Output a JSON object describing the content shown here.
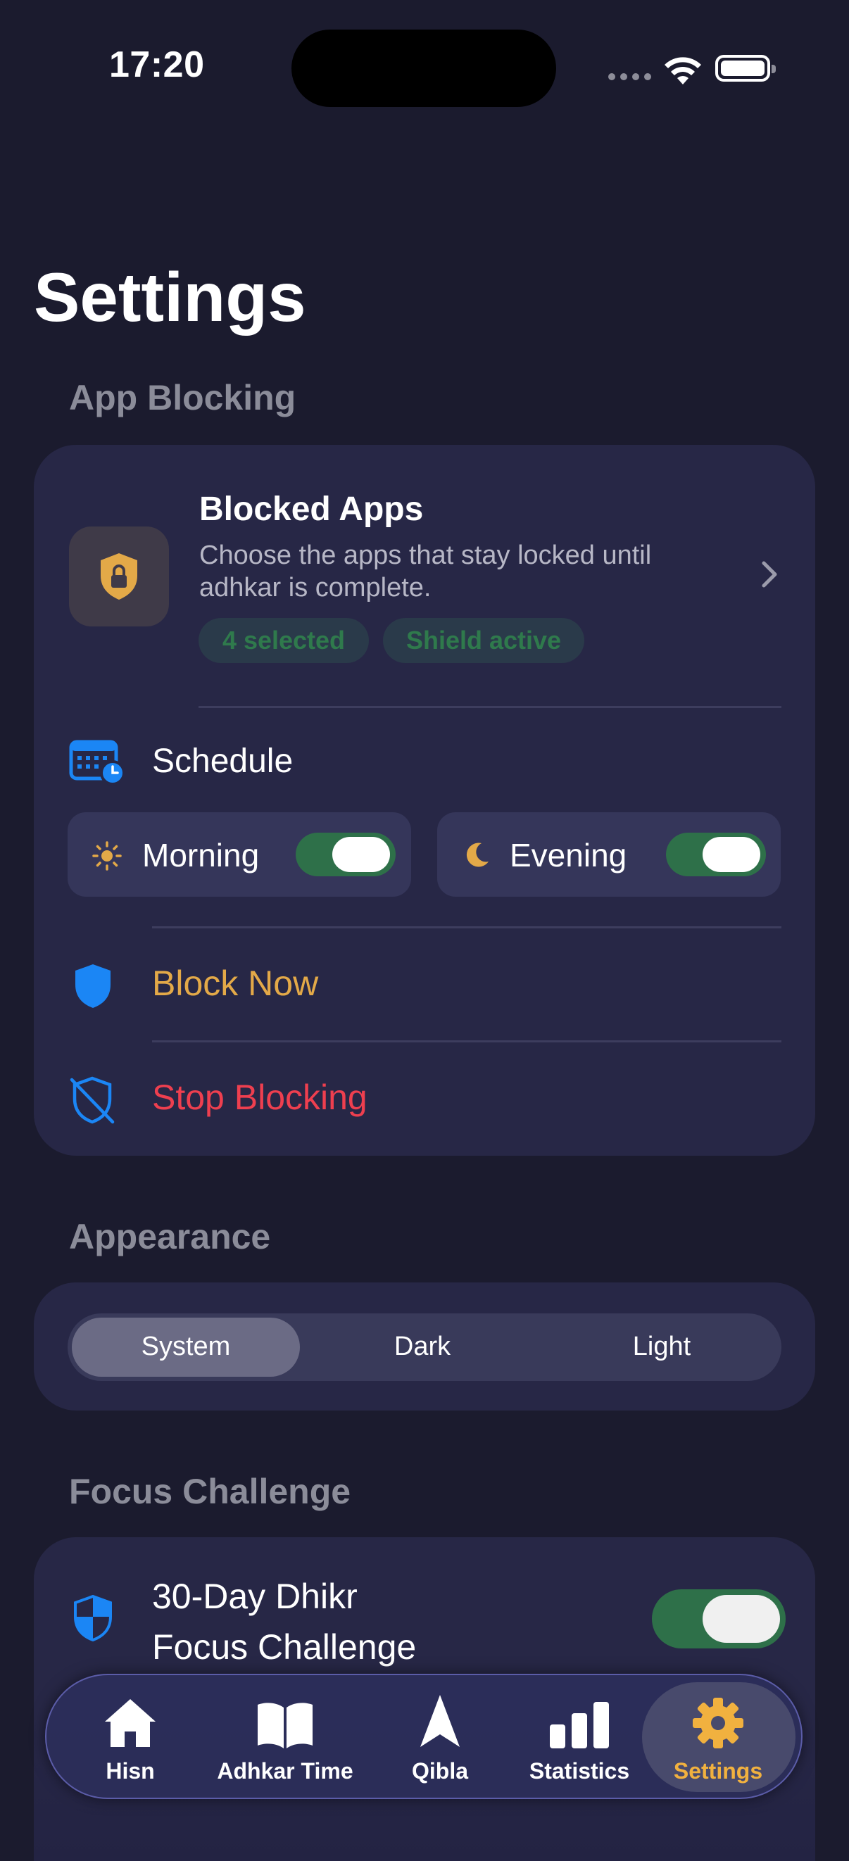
{
  "status_bar": {
    "time": "17:20"
  },
  "page": {
    "title": "Settings"
  },
  "app_blocking": {
    "section_label": "App Blocking",
    "blocked_apps": {
      "title": "Blocked Apps",
      "description": "Choose the apps that stay locked until adhkar is complete.",
      "badges": [
        "4 selected",
        "Shield active"
      ],
      "icon": "lock-shield-icon"
    },
    "schedule": {
      "label": "Schedule",
      "icon": "calendar-clock-icon",
      "morning": {
        "label": "Morning",
        "icon": "sun-icon",
        "enabled": true
      },
      "evening": {
        "label": "Evening",
        "icon": "moon-icon",
        "enabled": true
      }
    },
    "block_now": {
      "label": "Block Now",
      "icon": "shield-icon"
    },
    "stop_blocking": {
      "label": "Stop Blocking",
      "icon": "shield-slash-icon"
    }
  },
  "appearance": {
    "section_label": "Appearance",
    "options": [
      "System",
      "Dark",
      "Light"
    ],
    "selected": "System"
  },
  "focus_challenge": {
    "section_label": "Focus Challenge",
    "title_line1": "30-Day Dhikr",
    "title_line2": "Focus Challenge",
    "enabled": true,
    "icon": "shield-half-icon"
  },
  "tab_bar": {
    "items": [
      {
        "label": "Hisn",
        "icon": "house-icon"
      },
      {
        "label": "Adhkar Time",
        "icon": "book-icon"
      },
      {
        "label": "Qibla",
        "icon": "location-arrow-icon"
      },
      {
        "label": "Statistics",
        "icon": "bar-chart-icon"
      },
      {
        "label": "Settings",
        "icon": "gear-icon"
      }
    ],
    "active": "Settings"
  },
  "colors": {
    "background": "#1b1b2e",
    "card": "#272746",
    "accent_gold": "#e3a948",
    "danger": "#ee3f4f",
    "toggle_on": "#2e7049",
    "blue": "#1b86f5"
  }
}
